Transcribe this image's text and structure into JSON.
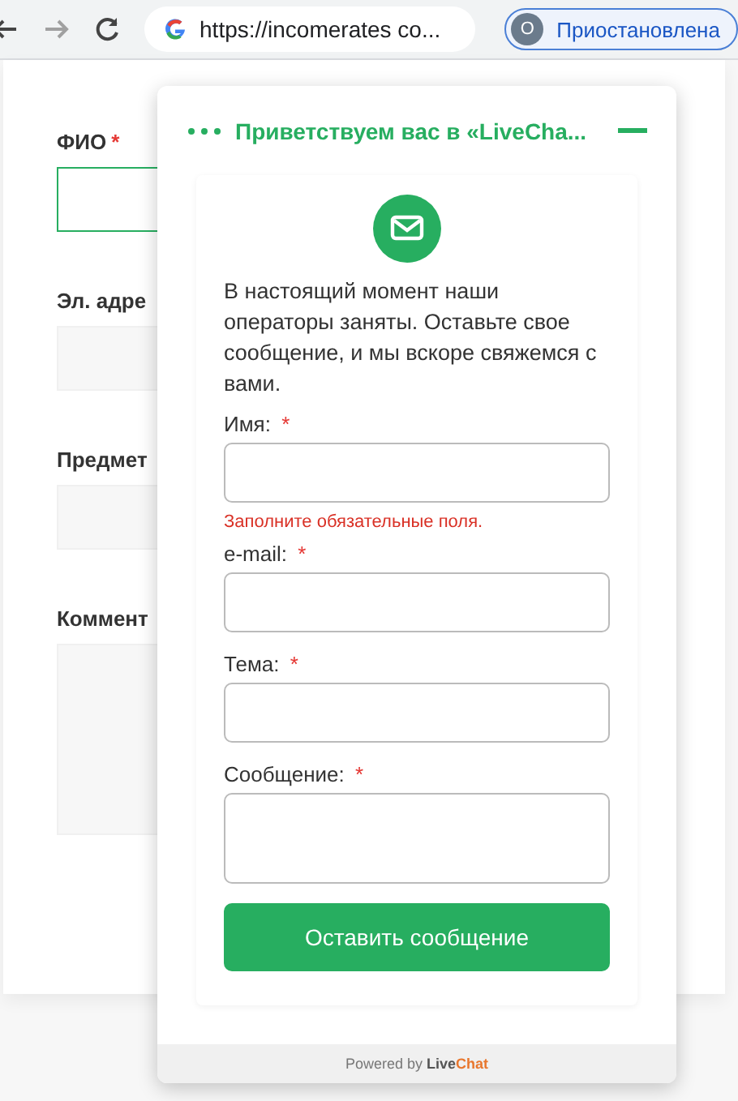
{
  "browser": {
    "back": {
      "disabled": false
    },
    "forward": {
      "disabled": true
    },
    "url": "https://incomerates co...",
    "profile": {
      "initial": "O",
      "status": "Приостановлена"
    }
  },
  "page_form": {
    "fields": [
      {
        "label": "ФИО",
        "mark": "*",
        "focused": true,
        "kind": "input"
      },
      {
        "label": "Эл. адре",
        "focused": false,
        "kind": "input"
      },
      {
        "label": "Предмет",
        "focused": false,
        "kind": "input"
      },
      {
        "label": "Коммент",
        "focused": false,
        "kind": "textarea"
      }
    ]
  },
  "chat": {
    "title": "Приветствуем вас в «LiveCha...",
    "intro": "В настоящий момент наши операторы заняты. Оставьте свое сообщение, и мы вскоре свяжемся с вами.",
    "fields": [
      {
        "label": "Имя:",
        "mark": "*",
        "kind": "input",
        "error": "Заполните обязательные поля."
      },
      {
        "label": "e-mail:",
        "mark": "*",
        "kind": "input"
      },
      {
        "label": "Тема:",
        "mark": "*",
        "kind": "input"
      },
      {
        "label": "Сообщение:",
        "mark": "*",
        "kind": "textarea"
      }
    ],
    "submit": "Оставить сообщение",
    "footer": {
      "text": "Powered by",
      "brand_a": "Live",
      "brand_b": "Chat"
    }
  }
}
